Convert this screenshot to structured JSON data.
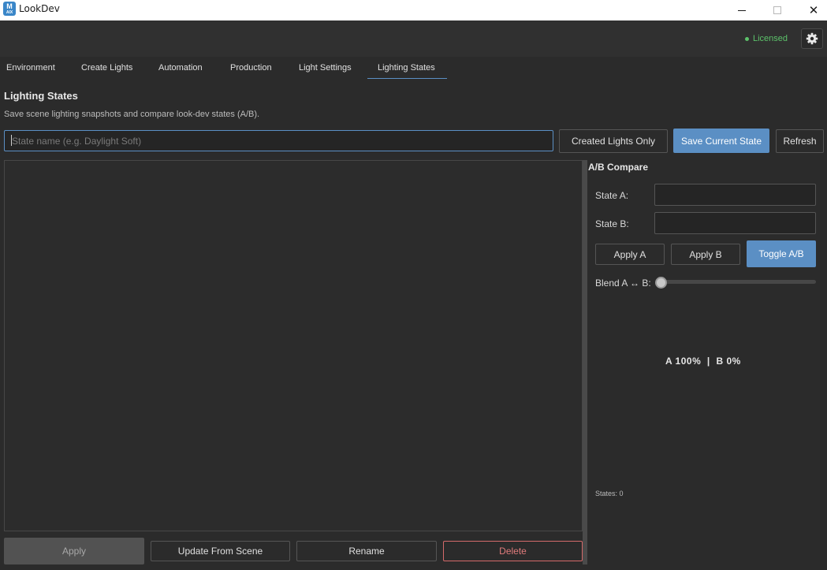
{
  "window": {
    "app_icon_letter": "M",
    "app_icon_sub": "AIX",
    "title": "LookDev",
    "min_icon": "minimize-icon",
    "max_icon": "maximize-icon",
    "close_icon": "close-icon",
    "close_glyph": "✕"
  },
  "header": {
    "license_text": "Licensed",
    "license_color": "#5cc26a",
    "settings_icon": "gear-icon"
  },
  "tabs": [
    {
      "label": "Environment"
    },
    {
      "label": "Create Lights"
    },
    {
      "label": "Automation"
    },
    {
      "label": "Production"
    },
    {
      "label": "Light Settings"
    },
    {
      "label": "Lighting States",
      "active": true
    }
  ],
  "section": {
    "title": "Lighting States",
    "description": "Save scene lighting snapshots and compare look-dev states (A/B)."
  },
  "toolbar": {
    "name_value": "",
    "name_placeholder": "State name (e.g. Daylight Soft)",
    "created_lights_label": "Created Lights Only",
    "save_label": "Save Current State",
    "refresh_label": "Refresh"
  },
  "states_list": {
    "items": []
  },
  "compare": {
    "title": "A/B Compare",
    "state_a_label": "State A:",
    "state_a_value": "",
    "state_b_label": "State B:",
    "state_b_value": "",
    "apply_a_label": "Apply A",
    "apply_b_label": "Apply B",
    "toggle_label": "Toggle A/B",
    "blend_label": "Blend A ↔ B:",
    "blend_value": 0,
    "blend_readout": "A 100%  |  B 0%",
    "states_count": "States: 0"
  },
  "actions": {
    "apply_label": "Apply",
    "update_label": "Update From Scene",
    "rename_label": "Rename",
    "delete_label": "Delete"
  },
  "colors": {
    "accent": "#5b8fc4",
    "danger": "#d46a6a",
    "background": "#2b2b2b"
  }
}
